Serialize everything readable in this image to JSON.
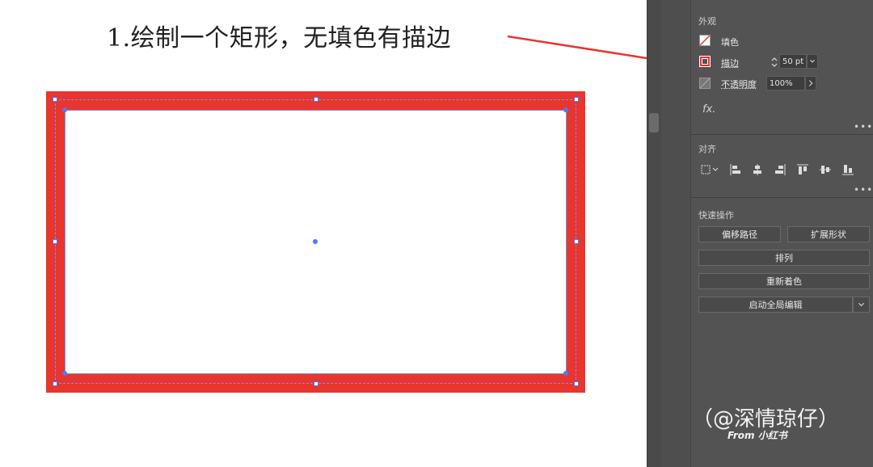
{
  "caption": "1.绘制一个矩形，无填色有描边",
  "panel": {
    "appearance_title": "外观",
    "fill_label": "填色",
    "stroke_label": "描边",
    "stroke_value": "50 pt",
    "opacity_label": "不透明度",
    "opacity_value": "100%",
    "fx_label": "fx.",
    "align_title": "对齐",
    "quick_title": "快速操作",
    "offset_path": "偏移路径",
    "expand_shape": "扩展形状",
    "arrange": "排列",
    "recolor": "重新着色",
    "global_edit": "启动全局编辑",
    "more": "•••"
  },
  "watermark": {
    "main": "（@深情琼仔）",
    "sub": "From 小红书"
  },
  "colors": {
    "stroke_red": "#e8352d",
    "selection_blue": "#4a7bff",
    "panel_bg": "#535353"
  }
}
